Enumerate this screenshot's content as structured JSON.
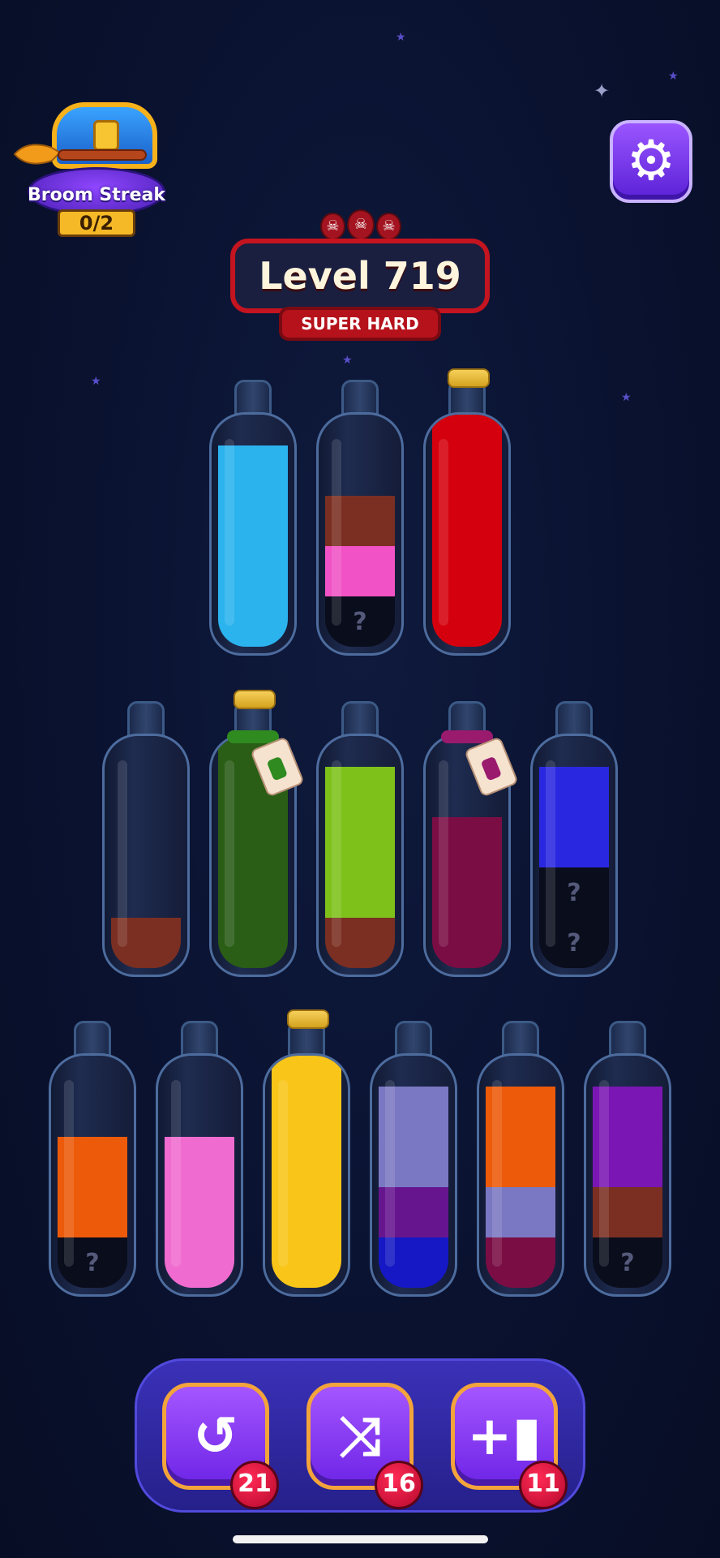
{
  "streak": {
    "label": "Broom Streak",
    "count": "0/2"
  },
  "level": {
    "title": "Level 719",
    "difficulty": "SUPER HARD"
  },
  "hidden_mark": "?",
  "colors": {
    "cyan": "#2bb3ee",
    "brown": "#7a2f22",
    "pink": "#f152c5",
    "red": "#d5000d",
    "dark_green": "#2a5d16",
    "lime": "#7ec11a",
    "magenta": "#7a0d44",
    "blue": "#2a27e0",
    "orange": "#ec5a0a",
    "light_pink": "#f06bd0",
    "yellow": "#f9c519",
    "lavender": "#7a78c2",
    "purple": "#66158f",
    "dark_blue": "#1518c4",
    "violet": "#7a16b3"
  },
  "bottles": [
    {
      "cork": false,
      "tag": null,
      "layers": [
        "cyan",
        "cyan",
        "cyan",
        "cyan"
      ]
    },
    {
      "cork": false,
      "tag": null,
      "layers": [
        "hidden",
        "pink",
        "brown"
      ]
    },
    {
      "cork": true,
      "tag": null,
      "layers": [
        "red",
        "red",
        "red",
        "red",
        "red"
      ]
    },
    {
      "cork": false,
      "tag": null,
      "layers": [
        "brown"
      ]
    },
    {
      "cork": true,
      "tag": "green",
      "layers": [
        "dark_green",
        "dark_green",
        "dark_green",
        "dark_green",
        "dark_green"
      ]
    },
    {
      "cork": false,
      "tag": null,
      "layers": [
        "brown",
        "lime",
        "lime",
        "lime"
      ]
    },
    {
      "cork": false,
      "tag": "magenta",
      "layers": [
        "magenta",
        "magenta",
        "magenta"
      ]
    },
    {
      "cork": false,
      "tag": null,
      "layers": [
        "hidden",
        "hidden",
        "blue",
        "blue"
      ]
    },
    {
      "cork": false,
      "tag": null,
      "layers": [
        "hidden",
        "orange",
        "orange"
      ]
    },
    {
      "cork": false,
      "tag": null,
      "layers": [
        "light_pink",
        "light_pink",
        "light_pink"
      ]
    },
    {
      "cork": true,
      "tag": null,
      "layers": [
        "yellow",
        "yellow",
        "yellow",
        "yellow",
        "yellow"
      ]
    },
    {
      "cork": false,
      "tag": null,
      "layers": [
        "dark_blue",
        "purple",
        "lavender",
        "lavender"
      ]
    },
    {
      "cork": false,
      "tag": null,
      "layers": [
        "magenta",
        "lavender",
        "orange",
        "orange"
      ]
    },
    {
      "cork": false,
      "tag": null,
      "layers": [
        "hidden",
        "brown",
        "violet",
        "violet"
      ]
    }
  ],
  "toolbar": [
    {
      "name": "undo-button",
      "icon": "undo-icon",
      "glyph": "↺",
      "count": "21"
    },
    {
      "name": "shuffle-button",
      "icon": "shuffle-icon",
      "glyph": "⤨",
      "count": "16"
    },
    {
      "name": "add-bottle-button",
      "icon": "add-bottle-icon",
      "glyph": "+▮",
      "count": "11"
    }
  ]
}
